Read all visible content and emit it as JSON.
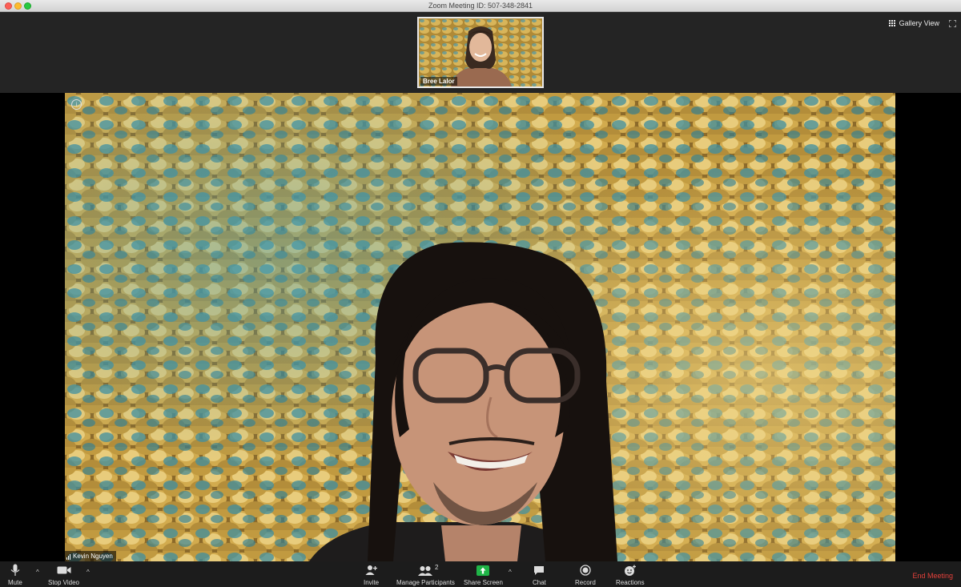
{
  "window": {
    "title": "Zoom Meeting ID: 507-348-2841"
  },
  "top_bar": {
    "gallery_view_label": "Gallery View"
  },
  "thumbnail": {
    "participant_name": "Bree Lalor"
  },
  "main_video": {
    "participant_name": "Kevin Nguyen"
  },
  "toolbar": {
    "mute_label": "Mute",
    "stop_video_label": "Stop Video",
    "invite_label": "Invite",
    "manage_participants_label": "Manage Participants",
    "participants_count": "2",
    "share_screen_label": "Share Screen",
    "chat_label": "Chat",
    "record_label": "Record",
    "reactions_label": "Reactions",
    "end_meeting_label": "End Meeting"
  },
  "colors": {
    "end_meeting": "#e5413b",
    "share_screen_green": "#1fb447",
    "background_gold": "#c9a040",
    "background_teal": "#3f8fa0"
  }
}
